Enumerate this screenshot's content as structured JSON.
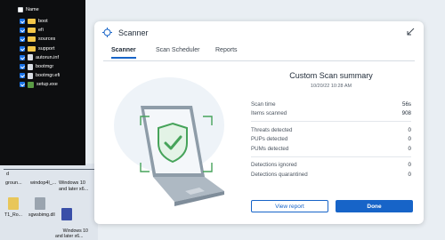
{
  "explorer": {
    "header_label": "Name",
    "files": [
      {
        "name": "boot",
        "kind": "folder"
      },
      {
        "name": "efi",
        "kind": "folder"
      },
      {
        "name": "sources",
        "kind": "folder"
      },
      {
        "name": "support",
        "kind": "folder"
      },
      {
        "name": "autorun.inf",
        "kind": "file"
      },
      {
        "name": "bootmgr",
        "kind": "file"
      },
      {
        "name": "bootmgr.efi",
        "kind": "file"
      },
      {
        "name": "setup.exe",
        "kind": "exe"
      }
    ]
  },
  "desktop": {
    "row_labels": [
      "d",
      "groun...",
      "windop4l_...",
      "Windows 10\nand later x6..."
    ],
    "icons": [
      {
        "label": "T1_Ro...",
        "icon": "file-icon",
        "color": "#e8c65a"
      },
      {
        "label": "sgwsbimg.dll",
        "icon": "gear-file-icon",
        "color": "#9aa4af"
      },
      {
        "label": "Windows 10\nand later x6...",
        "icon": "window-icon",
        "color": "#3a4fa8"
      }
    ]
  },
  "window": {
    "title": "Scanner",
    "tabs": [
      {
        "label": "Scanner",
        "active": true
      },
      {
        "label": "Scan Scheduler",
        "active": false
      },
      {
        "label": "Reports",
        "active": false
      }
    ]
  },
  "summary": {
    "title": "Custom Scan summary",
    "date": "10/20/22 10:28 AM",
    "stats_group1": [
      {
        "label": "Scan time",
        "value": "56s"
      },
      {
        "label": "Items scanned",
        "value": "908"
      }
    ],
    "stats_group2": [
      {
        "label": "Threats detected",
        "value": "0"
      },
      {
        "label": "PUPs detected",
        "value": "0"
      },
      {
        "label": "PUMs detected",
        "value": "0"
      }
    ],
    "stats_group3": [
      {
        "label": "Detections ignored",
        "value": "0"
      },
      {
        "label": "Detections quarantined",
        "value": "0"
      }
    ],
    "view_report_label": "View report",
    "done_label": "Done"
  },
  "colors": {
    "accent": "#1764c8",
    "shield": "#46a35a",
    "laptop": "#7f8d9a"
  }
}
